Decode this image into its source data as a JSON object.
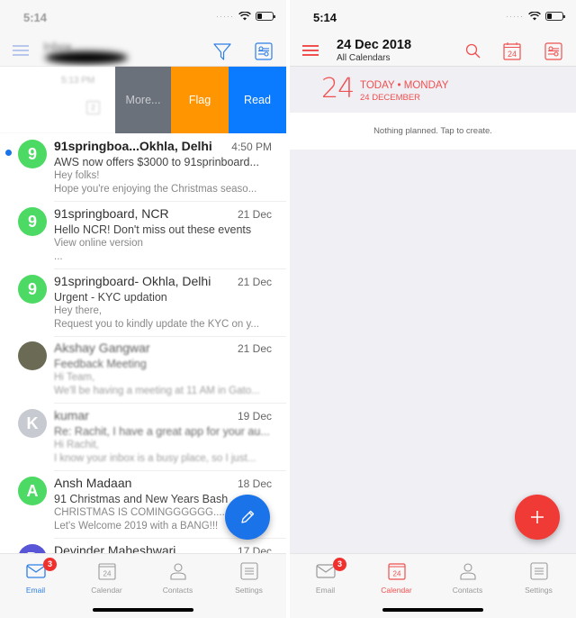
{
  "colors": {
    "email_accent": "#1a73e8",
    "calendar_accent": "#f05050",
    "swipe_more": "#6b717a",
    "swipe_flag": "#ff9500",
    "swipe_read": "#0a7aff",
    "badge": "#f0302c"
  },
  "left": {
    "status_time": "5:14",
    "header": {
      "title_blurred": "Inbox",
      "menu_icon": "hamburger-icon",
      "filter_icon": "filter-icon",
      "settings_icon": "sliders-icon"
    },
    "swiped_row": {
      "time": "5:13 PM",
      "count": "2",
      "actions": [
        "More...",
        "Flag",
        "Read"
      ]
    },
    "messages": [
      {
        "initial": "9",
        "avatar_color": "#4cd964",
        "sender": "91springboa...Okhla, Delhi",
        "date": "4:50 PM",
        "subject": "AWS now offers $3000 to 91sprinboard...",
        "preview1": "Hey folks!",
        "preview2": "Hope you're enjoying the Christmas seaso...",
        "unread": true
      },
      {
        "initial": "9",
        "avatar_color": "#4cd964",
        "sender": "91springboard, NCR",
        "date": "21 Dec",
        "subject": "Hello NCR! Don't miss out these events",
        "preview1": "View online version",
        "preview2": "...",
        "unread": false
      },
      {
        "initial": "9",
        "avatar_color": "#4cd964",
        "sender": "91springboard- Okhla, Delhi",
        "date": "21 Dec",
        "subject": "Urgent - KYC updation",
        "preview1": "Hey there,",
        "preview2": "Request you to kindly update the KYC on y...",
        "unread": false
      },
      {
        "initial": "",
        "avatar_color": "#6b6b55",
        "sender": "Akshay Gangwar",
        "date": "21 Dec",
        "subject": "Feedback Meeting",
        "preview1": "Hi Team,",
        "preview2": "We'll be having a meeting at 11 AM in Gato...",
        "unread": false
      },
      {
        "initial": "K",
        "avatar_color": "#c7cad1",
        "sender": "kumar",
        "date": "19 Dec",
        "subject": "Re: Rachit, I have a great app for your au...",
        "preview1": "Hi Rachit,",
        "preview2": "I know your inbox is a busy place, so I just...",
        "unread": false
      },
      {
        "initial": "A",
        "avatar_color": "#4cd964",
        "sender": "Ansh Madaan",
        "date": "18 Dec",
        "subject": "91 Christmas and New Years Bash",
        "preview1": "CHRISTMAS IS COMINGGGGGG....",
        "preview2": "Let's Welcome 2019 with a BANG!!!",
        "unread": false
      },
      {
        "initial": "D",
        "avatar_color": "#5856d6",
        "sender": "Devinder Maheshwari",
        "date": "17 Dec",
        "subject": "",
        "preview1": "",
        "preview2": "",
        "unread": false
      }
    ],
    "fab_icon": "pencil-icon",
    "tabs": [
      {
        "label": "Email",
        "icon": "mail-icon",
        "badge": "3",
        "active": true
      },
      {
        "label": "Calendar",
        "icon": "calendar-icon",
        "icon_text": "24"
      },
      {
        "label": "Contacts",
        "icon": "person-icon"
      },
      {
        "label": "Settings",
        "icon": "settings-icon"
      }
    ]
  },
  "right": {
    "status_time": "5:14",
    "header": {
      "date": "24 Dec 2018",
      "subtitle": "All Calendars",
      "calendar_icon_text": "24"
    },
    "day": {
      "number": "24",
      "line1": "TODAY • MONDAY",
      "line2": "24 DECEMBER"
    },
    "empty_text": "Nothing planned. Tap to create.",
    "fab_icon": "plus-icon",
    "tabs": [
      {
        "label": "Email",
        "icon": "mail-icon",
        "badge": "3"
      },
      {
        "label": "Calendar",
        "icon": "calendar-icon",
        "icon_text": "24",
        "active": true
      },
      {
        "label": "Contacts",
        "icon": "person-icon"
      },
      {
        "label": "Settings",
        "icon": "settings-icon"
      }
    ]
  }
}
